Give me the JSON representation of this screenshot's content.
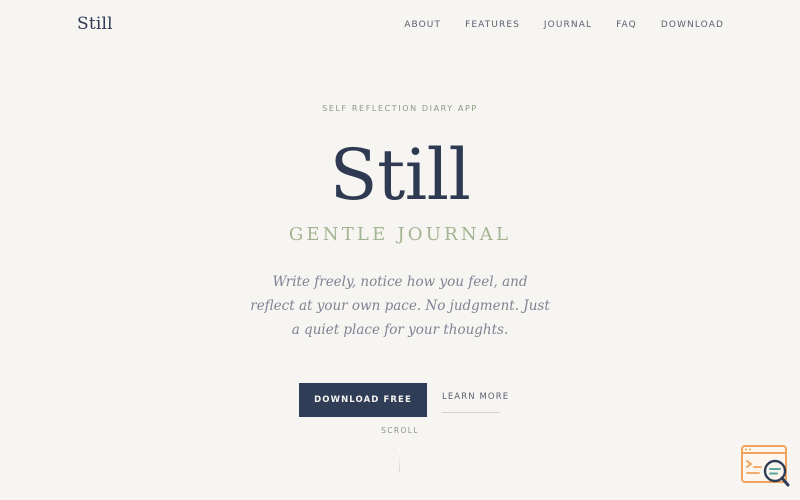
{
  "brand": {
    "logo": "Still"
  },
  "nav": {
    "links": [
      "ABOUT",
      "FEATURES",
      "JOURNAL",
      "FAQ",
      "DOWNLOAD"
    ]
  },
  "hero": {
    "eyebrow": "SELF REFLECTION DIARY APP",
    "headline": "Still",
    "subhead": "GENTLE JOURNAL",
    "tagline": "Write freely, notice how you feel, and reflect at your own pace. No judgment. Just a quiet place for your thoughts."
  },
  "cta": {
    "primary": "DOWNLOAD FREE",
    "secondary": "LEARN MORE"
  },
  "scroll": {
    "label": "SCROLL"
  },
  "colors": {
    "background": "#f7f5f1",
    "ink": "#2f3a52",
    "accent_sage": "#a3b493",
    "button": "#2f3d56",
    "widget_orange": "#f0a35a"
  },
  "widget": {
    "icon": "search-chat-icon"
  }
}
